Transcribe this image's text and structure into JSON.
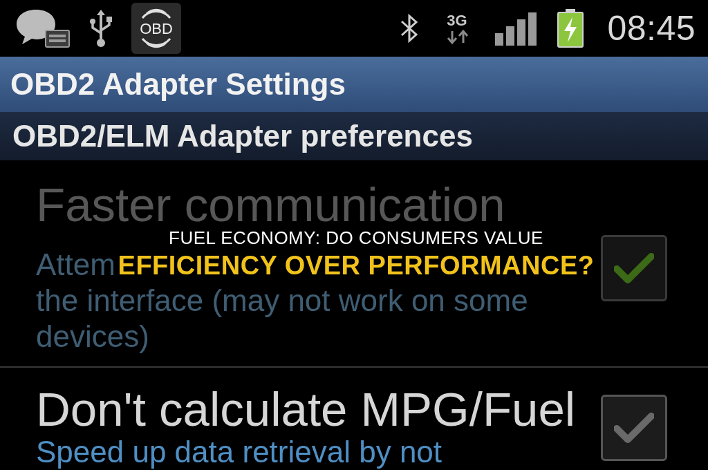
{
  "status_bar": {
    "app_icon_label": "OBD",
    "network_type": "3G",
    "time": "08:45"
  },
  "title_bar": {
    "title": "OBD2 Adapter Settings"
  },
  "category": {
    "title": "OBD2/ELM Adapter preferences"
  },
  "settings": [
    {
      "title": "Faster communication",
      "summary_lines": [
        "Attem",
        "the interface (may not work on some",
        "devices)"
      ],
      "checked": true,
      "disabled": true
    },
    {
      "title": "Don't calculate MPG/Fuel",
      "summary_lines": [
        "Speed up data retrieval by not"
      ],
      "checked": false,
      "disabled": false
    }
  ],
  "headline": {
    "lines": [
      "FUEL ECONOMY: DO CONSUMERS VALUE",
      "EFFICIENCY OVER PERFORMANCE?"
    ]
  }
}
